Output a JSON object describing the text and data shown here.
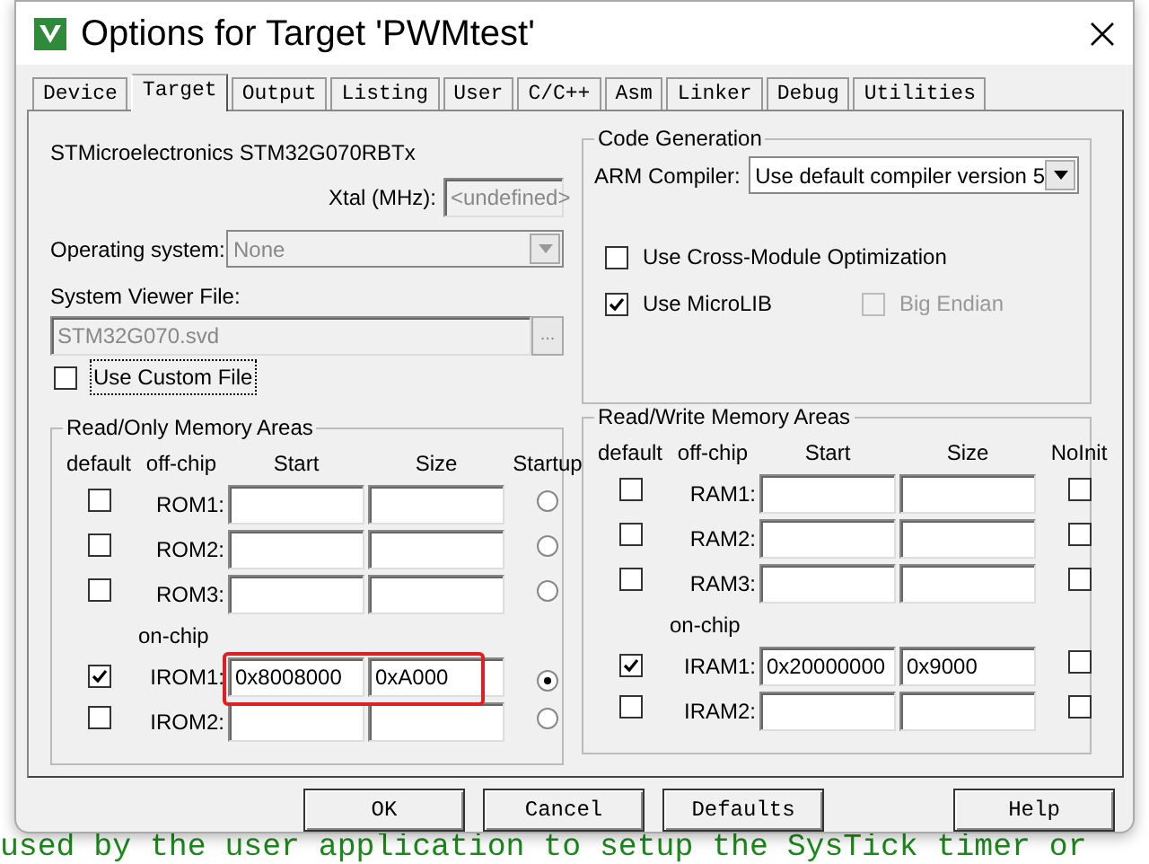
{
  "background_code": "used by the user application to setup the SysTick timer or",
  "window": {
    "title": "Options for Target 'PWMtest'"
  },
  "tabs": [
    {
      "label": "Device",
      "selected": false
    },
    {
      "label": "Target",
      "selected": true
    },
    {
      "label": "Output",
      "selected": false
    },
    {
      "label": "Listing",
      "selected": false
    },
    {
      "label": "User",
      "selected": false
    },
    {
      "label": "C/C++",
      "selected": false
    },
    {
      "label": "Asm",
      "selected": false
    },
    {
      "label": "Linker",
      "selected": false
    },
    {
      "label": "Debug",
      "selected": false
    },
    {
      "label": "Utilities",
      "selected": false
    }
  ],
  "device": "STMicroelectronics STM32G070RBTx",
  "xtal": {
    "label": "Xtal (MHz):",
    "value": "<undefined>",
    "disabled": true
  },
  "operating_system": {
    "label": "Operating system:",
    "value": "None",
    "disabled": true
  },
  "system_viewer": {
    "label": "System Viewer File:",
    "value": "STM32G070.svd",
    "disabled": true,
    "browse": "..."
  },
  "custom_file": {
    "label": "Use Custom File",
    "checked": false,
    "focused": true
  },
  "code_generation": {
    "title": "Code Generation",
    "compiler_label": "ARM Compiler:",
    "compiler": "Use default compiler version 5",
    "options": [
      {
        "label": "Use Cross-Module Optimization",
        "checked": false,
        "disabled": false
      },
      {
        "label": "Use MicroLIB",
        "checked": true,
        "disabled": false
      },
      {
        "label": "Big Endian",
        "checked": false,
        "disabled": true
      }
    ]
  },
  "rom": {
    "title": "Read/Only Memory Areas",
    "headers": [
      "default",
      "off-chip",
      "Start",
      "Size",
      "Startup"
    ],
    "on_chip_label": "on-chip",
    "rows": [
      {
        "name": "ROM1:",
        "kind": "off-chip",
        "default": false,
        "flag": false
      },
      {
        "name": "ROM2:",
        "kind": "off-chip",
        "default": false,
        "flag": false
      },
      {
        "name": "ROM3:",
        "kind": "off-chip",
        "default": false,
        "flag": false
      },
      {
        "name": "IROM1:",
        "kind": "on-chip",
        "default": true,
        "start": "0x8008000",
        "size": "0xA000",
        "flag": true,
        "highlighted": true
      },
      {
        "name": "IROM2:",
        "kind": "on-chip",
        "default": false,
        "flag": false
      }
    ]
  },
  "ram": {
    "title": "Read/Write Memory Areas",
    "headers": [
      "default",
      "off-chip",
      "Start",
      "Size",
      "NoInit"
    ],
    "on_chip_label": "on-chip",
    "rows": [
      {
        "name": "RAM1:",
        "kind": "off-chip",
        "default": false,
        "flag": false
      },
      {
        "name": "RAM2:",
        "kind": "off-chip",
        "default": false,
        "flag": false
      },
      {
        "name": "RAM3:",
        "kind": "off-chip",
        "default": false,
        "flag": false
      },
      {
        "name": "IRAM1:",
        "kind": "on-chip",
        "default": true,
        "start": "0x20000000",
        "size": "0x9000",
        "flag": false
      },
      {
        "name": "IRAM2:",
        "kind": "on-chip",
        "default": false,
        "flag": false
      }
    ]
  },
  "buttons": [
    {
      "label": "OK",
      "kind": "left"
    },
    {
      "label": "Cancel",
      "kind": "left"
    },
    {
      "label": "Defaults",
      "kind": "left"
    },
    {
      "label": "Help",
      "kind": "right"
    }
  ]
}
